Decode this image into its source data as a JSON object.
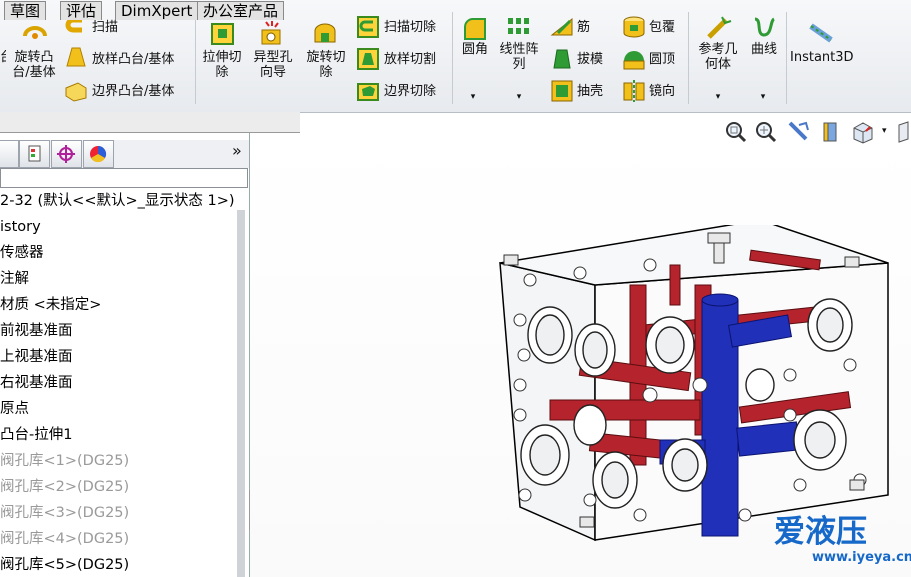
{
  "ribbon": {
    "revolve_boss": "旋转凸台/基体",
    "sweep": "扫描",
    "loft_boss": "放样凸台/基体",
    "boundary_boss": "边界凸台/基体",
    "extruded_cut": "拉伸切除",
    "hole_wizard": "异型孔向导",
    "revolved_cut": "旋转切除",
    "swept_cut": "扫描切除",
    "lofted_cut": "放样切割",
    "boundary_cut": "边界切除",
    "fillet": "圆角",
    "linear_pattern": "线性阵列",
    "rib": "筋",
    "draft": "拔模",
    "shell": "抽壳",
    "wrap": "包覆",
    "dome": "圆顶",
    "mirror": "镜向",
    "ref_geometry": "参考几何体",
    "curves": "曲线",
    "instant3d": "Instant3D"
  },
  "tabs": [
    "草图",
    "评估",
    "DimXpert",
    "办公室产品"
  ],
  "tree": {
    "root": "2-32  (默认<<默认>_显示状态 1>)",
    "items": [
      {
        "label": "istory",
        "grey": false
      },
      {
        "label": "传感器",
        "grey": false
      },
      {
        "label": "注解",
        "grey": false
      },
      {
        "label": "材质 <未指定>",
        "grey": false
      },
      {
        "label": "前视基准面",
        "grey": false
      },
      {
        "label": "上视基准面",
        "grey": false
      },
      {
        "label": "右视基准面",
        "grey": false
      },
      {
        "label": "原点",
        "grey": false
      },
      {
        "label": "凸台-拉伸1",
        "grey": false
      },
      {
        "label": "阀孔库<1>(DG25)",
        "grey": true
      },
      {
        "label": "阀孔库<2>(DG25)",
        "grey": true
      },
      {
        "label": "阀孔库<3>(DG25)",
        "grey": true
      },
      {
        "label": "阀孔库<4>(DG25)",
        "grey": true
      },
      {
        "label": "阀孔库<5>(DG25)",
        "grey": false
      }
    ]
  },
  "panel": {
    "expand": "»"
  },
  "watermark": {
    "title": "爱液压",
    "url": "www.iyeya.cn",
    "color": "#1769c9"
  }
}
